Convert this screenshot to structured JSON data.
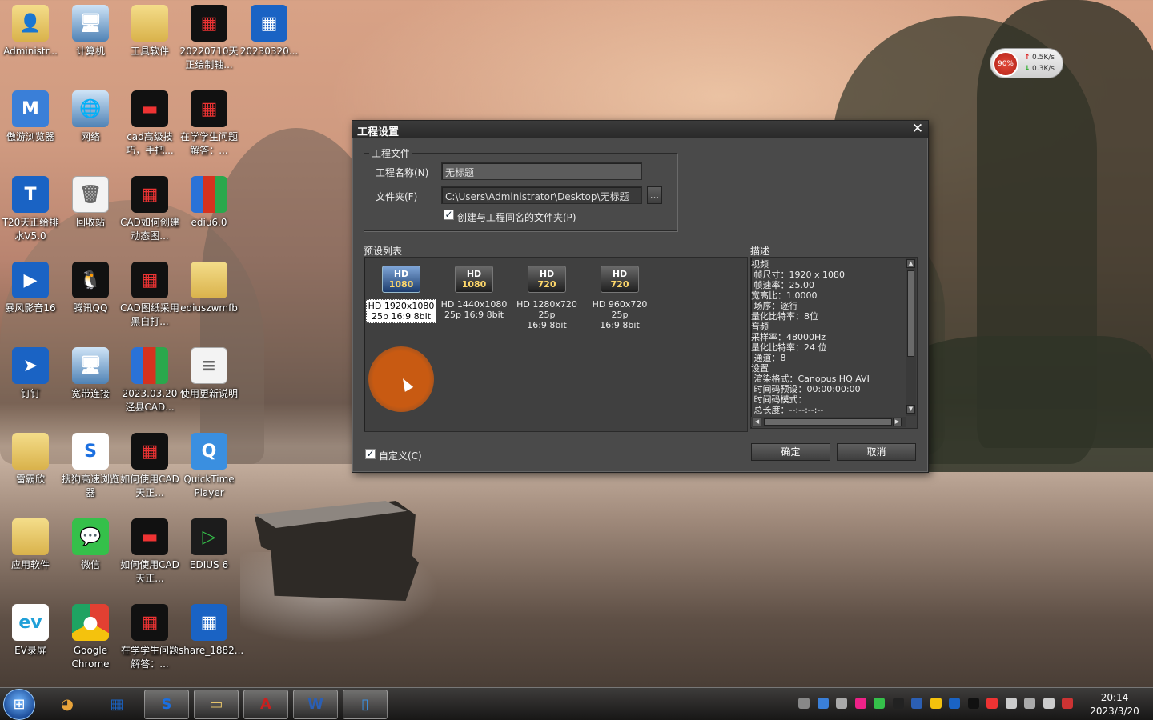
{
  "desktop": {
    "icons": [
      {
        "label": "Administr...",
        "icon": "user-folder-icon",
        "glyph": "👤"
      },
      {
        "label": "计算机",
        "icon": "computer-icon",
        "glyph": "🖥"
      },
      {
        "label": "工具软件",
        "icon": "folder-icon",
        "glyph": ""
      },
      {
        "label": "20220710天正绘制轴...",
        "icon": "video-file-icon",
        "glyph": "▦"
      },
      {
        "label": "20230320...",
        "icon": "video-project-icon",
        "glyph": "▦"
      },
      {
        "label": "傲游浏览器",
        "icon": "maxthon-browser-icon",
        "glyph": "M"
      },
      {
        "label": "网络",
        "icon": "network-icon",
        "glyph": "🌐"
      },
      {
        "label": "cad高级技巧，手把...",
        "icon": "video-file-icon",
        "glyph": "▬"
      },
      {
        "label": "在学学生问题解答：...",
        "icon": "video-file-icon",
        "glyph": "▦"
      },
      {
        "label": "T20天正给排水V5.0",
        "icon": "t20-app-icon",
        "glyph": "T"
      },
      {
        "label": "回收站",
        "icon": "recycle-bin-icon",
        "glyph": "🗑"
      },
      {
        "label": "CAD如何创建动态图...",
        "icon": "video-file-icon",
        "glyph": "▦"
      },
      {
        "label": "ediu6.0",
        "icon": "archive-icon",
        "glyph": ""
      },
      {
        "label": "暴风影音16",
        "icon": "baofeng-player-icon",
        "glyph": "▶"
      },
      {
        "label": "腾讯QQ",
        "icon": "qq-icon",
        "glyph": "🐧"
      },
      {
        "label": "CAD图纸采用黑白打...",
        "icon": "video-file-icon",
        "glyph": "▦"
      },
      {
        "label": "ediuszwmfb",
        "icon": "document-icon",
        "glyph": ""
      },
      {
        "label": "钉钉",
        "icon": "dingtalk-icon",
        "glyph": "➤"
      },
      {
        "label": "宽带连接",
        "icon": "broadband-icon",
        "glyph": "🖥"
      },
      {
        "label": "2023.03.20泾县CAD...",
        "icon": "archive-icon",
        "glyph": ""
      },
      {
        "label": "使用更新说明",
        "icon": "text-file-icon",
        "glyph": "≡"
      },
      {
        "label": "雷霸欣",
        "icon": "folder-icon",
        "glyph": ""
      },
      {
        "label": "搜狗高速浏览器",
        "icon": "sogou-browser-icon",
        "glyph": "S"
      },
      {
        "label": "如何使用CAD天正...",
        "icon": "video-file-icon",
        "glyph": "▦"
      },
      {
        "label": "QuickTime Player",
        "icon": "quicktime-icon",
        "glyph": "Q"
      },
      {
        "label": "应用软件",
        "icon": "folder-icon",
        "glyph": ""
      },
      {
        "label": "微信",
        "icon": "wechat-icon",
        "glyph": "💬"
      },
      {
        "label": "如何使用CAD天正...",
        "icon": "video-file-icon",
        "glyph": "▬"
      },
      {
        "label": "EDIUS 6",
        "icon": "edius-icon",
        "glyph": "▷"
      },
      {
        "label": "EV录屏",
        "icon": "ev-recorder-icon",
        "glyph": "ev"
      },
      {
        "label": "Google Chrome",
        "icon": "chrome-icon",
        "glyph": "●"
      },
      {
        "label": "在学学生问题解答：...",
        "icon": "video-file-icon",
        "glyph": "▦"
      },
      {
        "label": "share_1882...",
        "icon": "video-project-icon",
        "glyph": "▦"
      }
    ]
  },
  "net_widget": {
    "percent": "90%",
    "up": "0.5K/s",
    "down": "0.3K/s"
  },
  "dialog": {
    "title": "工程设置",
    "close": "✕",
    "project_group": {
      "label": "工程文件",
      "name_label": "工程名称(N)",
      "name_value": "无标题",
      "folder_label": "文件夹(F)",
      "folder_value": "C:\\Users\\Administrator\\Desktop\\无标题",
      "browse": "...",
      "create_folder_label": "创建与工程同名的文件夹(P)",
      "create_folder_checked": true
    },
    "preset_label": "预设列表",
    "presets": [
      {
        "top": "HD",
        "res": "1080",
        "line1": "HD 1920x1080",
        "line2": "25p 16:9 8bit",
        "selected": true
      },
      {
        "top": "HD",
        "res": "1080",
        "line1": "HD 1440x1080",
        "line2": "25p 16:9 8bit",
        "selected": false
      },
      {
        "top": "HD",
        "res": "720",
        "line1": "HD 1280x720 25p",
        "line2": "16:9 8bit",
        "selected": false
      },
      {
        "top": "HD",
        "res": "720",
        "line1": "HD 960x720 25p",
        "line2": "16:9 8bit",
        "selected": false
      }
    ],
    "desc_label": "描述",
    "desc_lines": [
      "视频",
      " 帧尺寸：1920 x 1080",
      " 帧速率：25.00",
      "宽高比：1.0000",
      " 场序：逐行",
      "量化比特率：8位",
      "音频",
      "采样率：48000Hz",
      "量化比特率：24 位",
      " 通道：8",
      "设置",
      " 渲染格式：Canopus HQ AVI",
      " 时间码预设：00:00:00:00",
      " 时间码模式：",
      " 总长度：--:--:--:--"
    ],
    "custom_label": "自定义(C)",
    "custom_checked": true,
    "ok": "确定",
    "cancel": "取消"
  },
  "taskbar": {
    "start": "⊞",
    "apps": [
      {
        "icon": "app-launcher-icon",
        "glyph": "◕"
      },
      {
        "icon": "baofeng-player-icon",
        "glyph": "▦"
      },
      {
        "icon": "sogou-browser-icon",
        "glyph": "S"
      },
      {
        "icon": "file-explorer-icon",
        "glyph": "▭"
      },
      {
        "icon": "autocad-icon",
        "glyph": "A"
      },
      {
        "icon": "word-icon",
        "glyph": "W"
      },
      {
        "icon": "phone-mirror-icon",
        "glyph": "▯"
      }
    ],
    "time": "20:14",
    "date": "2023/3/20"
  }
}
